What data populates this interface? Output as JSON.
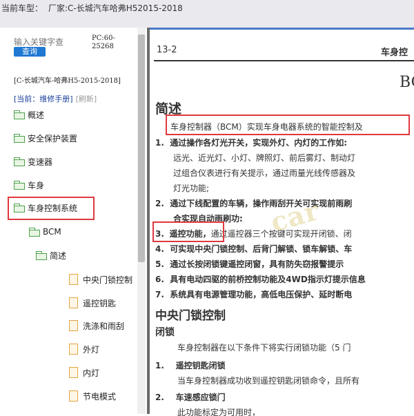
{
  "topbar": {
    "label": "当前车型：",
    "value": "厂家:C-长城汽车哈弗H52015-2018"
  },
  "sidebar": {
    "search_placeholder": "输入关键字查",
    "pc_code": "PC:60-25268",
    "query_button": "查询",
    "path": "[C-长城汽车-哈弗H5-2015-2018]",
    "current_prefix": "[当前：",
    "current_manual": "维修手册",
    "current_suffix": "]",
    "refresh": "[刷新]",
    "tree": [
      {
        "label": "概述"
      },
      {
        "label": "安全保护装置"
      },
      {
        "label": "变速器"
      },
      {
        "label": "车身"
      },
      {
        "label": "车身控制系统"
      },
      {
        "label": "BCM"
      },
      {
        "label": "简述"
      },
      {
        "label": "中央门锁控制"
      },
      {
        "label": "遥控钥匙"
      },
      {
        "label": "洗涤和雨刮"
      },
      {
        "label": "外灯"
      },
      {
        "label": "内灯"
      },
      {
        "label": "节电模式"
      }
    ]
  },
  "document": {
    "page_number": "13-2",
    "section_header": "车身控",
    "title": "BC",
    "heading1": "简述",
    "intro": "车身控制器（BCM）实现车身电器系统的智能控制及",
    "items": [
      {
        "num": "1.",
        "text": "通过操作各灯光开关，实现外灯、内灯的工作如:",
        "sub": [
          "远光、近光灯、小灯、牌照灯、前后雾灯、制动灯",
          "过组合仪表进行有关提示，通过雨量光线传感器及",
          "灯光功能;"
        ]
      },
      {
        "num": "2.",
        "text": "通过下线配置的车辆，操作雨刮开关可实现前雨刷",
        "sub": [
          "合实现自动雨刷功:"
        ]
      },
      {
        "num": "3.",
        "label": "遥控功能，",
        "text": "通过遥控器三个按键可实现开闭锁、闭"
      },
      {
        "num": "4.",
        "text": "可实现中央门锁控制、后背门解锁、锁车解锁、车"
      },
      {
        "num": "5.",
        "text": "通过长按闭锁键遥控闭窗，具有防失窃报警提示"
      },
      {
        "num": "6.",
        "text": "具有电动四驱的前桥控制功能及4WD指示灯提示信息"
      },
      {
        "num": "7.",
        "text": "系统具有电源管理功能，高低电压保护、延时断电"
      }
    ],
    "heading2": "中央门锁控制",
    "heading3": "闭锁",
    "lock_intro": "车身控制器在以下条件下将实行闭锁功能（5 门",
    "sub_items": [
      {
        "num": "1.",
        "title": "遥控钥匙闭锁",
        "text": "当车身控制器成功收到遥控钥匙闭锁命令，且所有"
      },
      {
        "num": "2.",
        "title": "车速感应锁门",
        "text": "此功能标定为可用时，"
      }
    ],
    "watermark": "car"
  },
  "colors": {
    "accent_blue": "#1f78d1",
    "highlight_red": "#e0383e",
    "folder_green": "#4aa04a",
    "doc_orange": "#e3a340"
  }
}
